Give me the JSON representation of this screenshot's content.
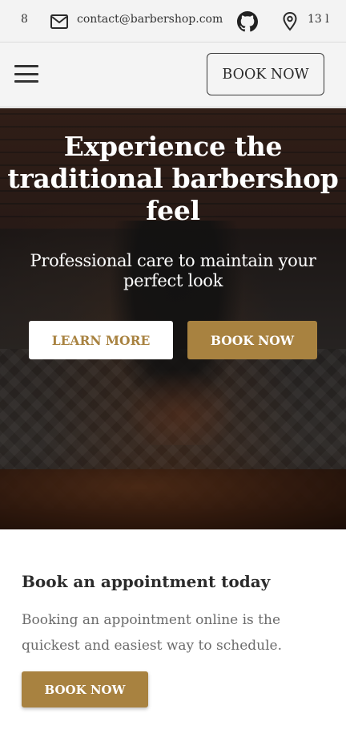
{
  "topbar": {
    "phone": "8",
    "email": "contact@barbershop.com",
    "address": "13 l",
    "icons": [
      "mail-icon",
      "github-icon",
      "map-pin-icon"
    ]
  },
  "navbar": {
    "menu_icon": "hamburger-menu-icon",
    "book_label": "BOOK NOW"
  },
  "hero": {
    "title": "Experience the traditional barbershop feel",
    "subtitle": "Professional care to maintain your perfect look",
    "learn_more_label": "LEARN MORE",
    "book_label": "BOOK NOW"
  },
  "appointment": {
    "heading": "Book an appointment today",
    "text": "Booking an appointment online is the quickest and easiest way to schedule.",
    "book_label": "BOOK NOW"
  },
  "colors": {
    "accent": "#a88240",
    "topbar_bg": "#f3f3f3",
    "navbar_bg": "#f4f4f4",
    "text_dark": "#2b2b2b",
    "text_muted": "#6b6b6b"
  }
}
